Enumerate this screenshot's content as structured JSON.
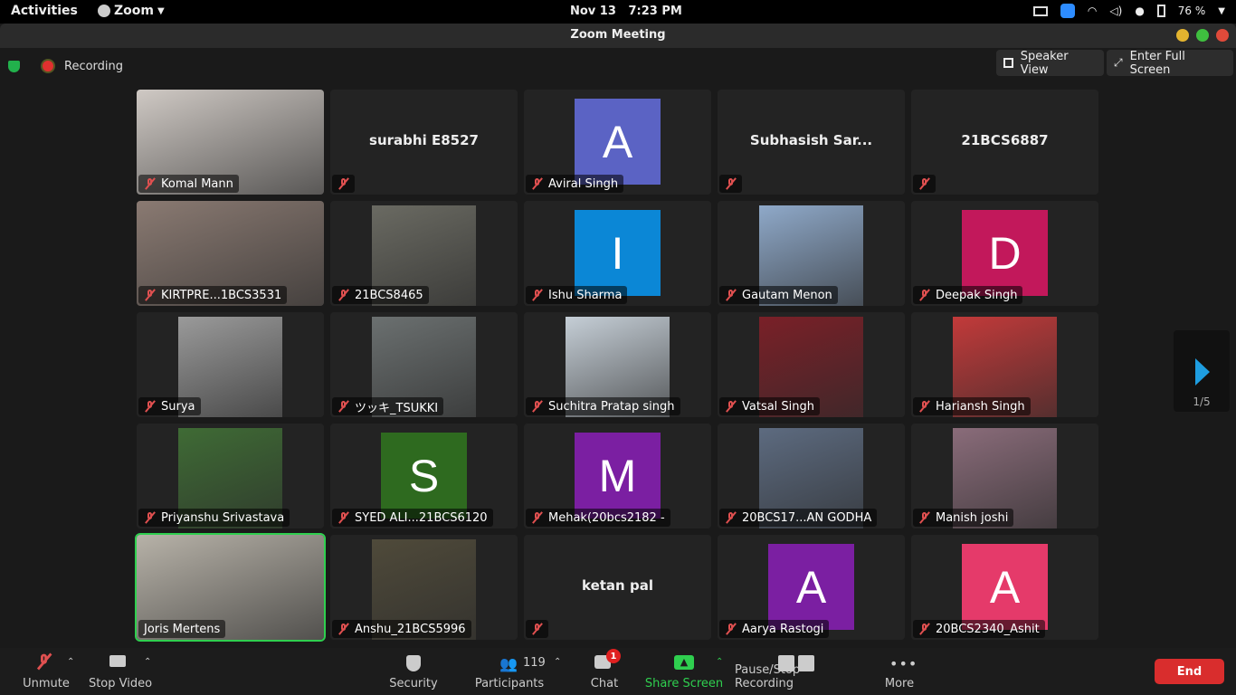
{
  "system_bar": {
    "activities": "Activities",
    "app_name": "Zoom",
    "date": "Nov 13",
    "time": "7:23 PM",
    "battery": "76 %"
  },
  "window": {
    "title": "Zoom Meeting"
  },
  "meeting_header": {
    "recording_label": "Recording",
    "speaker_view": "Speaker View",
    "enter_full_screen": "Enter Full Screen"
  },
  "tiles": [
    {
      "name": "Komal Mann",
      "kind": "photo",
      "color": "#cfc9c4"
    },
    {
      "name": "surabhi E8527",
      "kind": "bigname"
    },
    {
      "name": "Aviral Singh",
      "kind": "avatar",
      "initial": "A",
      "color": "#5b63c4"
    },
    {
      "name": "Subhasish Sar...",
      "kind": "bigname"
    },
    {
      "name": "21BCS6887",
      "kind": "bigname"
    },
    {
      "name": "KIRTPRE...1BCS3531",
      "kind": "photo",
      "color": "#8a7a72"
    },
    {
      "name": "21BCS8465",
      "kind": "photo",
      "color": "#6a6a62"
    },
    {
      "name": "Ishu Sharma",
      "kind": "avatar",
      "initial": "I",
      "color": "#0b87d6"
    },
    {
      "name": "Gautam Menon",
      "kind": "photo",
      "color": "#8fa9c9"
    },
    {
      "name": "Deepak Singh",
      "kind": "avatar",
      "initial": "D",
      "color": "#c2185b"
    },
    {
      "name": "Surya",
      "kind": "photo",
      "color": "#9a9a9a"
    },
    {
      "name": "ツッキ_TSUKKI",
      "kind": "photo",
      "color": "#6b7070"
    },
    {
      "name": "Suchitra Pratap singh",
      "kind": "photo",
      "color": "#c5ced6"
    },
    {
      "name": "Vatsal Singh",
      "kind": "photo",
      "color": "#7a2028"
    },
    {
      "name": "Hariansh Singh",
      "kind": "photo",
      "color": "#c23a3a"
    },
    {
      "name": "Priyanshu Srivastava",
      "kind": "photo",
      "color": "#3f6b35"
    },
    {
      "name": "SYED ALI...21BCS6120",
      "kind": "avatar",
      "initial": "S",
      "color": "#2e6a1f"
    },
    {
      "name": "Mehak(20bcs2182 -",
      "kind": "avatar",
      "initial": "M",
      "color": "#7b1fa2"
    },
    {
      "name": "20BCS17...AN GODHA",
      "kind": "photo",
      "color": "#5d6b80"
    },
    {
      "name": "Manish joshi",
      "kind": "photo",
      "color": "#8a6c7a"
    },
    {
      "name": "Joris Mertens",
      "kind": "photo",
      "color": "#b7b2a8",
      "active": true,
      "unmuted": true
    },
    {
      "name": "Anshu_21BCS5996",
      "kind": "photo",
      "color": "#4f4a3a"
    },
    {
      "name": "ketan pal",
      "kind": "bigname"
    },
    {
      "name": "Aarya Rastogi",
      "kind": "avatar",
      "initial": "A",
      "color": "#7b1fa2"
    },
    {
      "name": "20BCS2340_Ashit",
      "kind": "avatar",
      "initial": "A",
      "color": "#e53a6a"
    }
  ],
  "pager": {
    "page": "1/5"
  },
  "toolbar": {
    "unmute": "Unmute",
    "stop_video": "Stop Video",
    "security": "Security",
    "participants": "Participants",
    "participants_count": "119",
    "chat": "Chat",
    "chat_badge": "1",
    "share_screen": "Share Screen",
    "pause_recording": "Pause/Stop Recording",
    "more": "More",
    "end": "End"
  },
  "colors": {
    "accent_green": "#2fcf4f",
    "end_red": "#d92d2d",
    "pager_blue": "#1e9de0"
  }
}
